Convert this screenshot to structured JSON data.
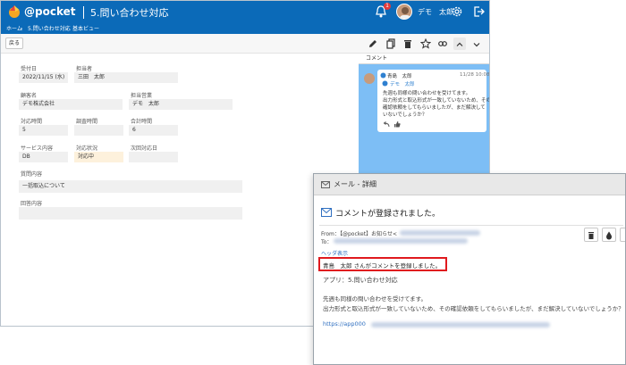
{
  "app": {
    "brand": "@pocket",
    "title": "5.問い合わせ対応",
    "notif_count": "1",
    "user_name": "デモ　太郎"
  },
  "breadcrumb": [
    "ホーム",
    "5.問い合わせ対応",
    "基本ビュー"
  ],
  "toolbar": {
    "back_label": "戻る"
  },
  "form": {
    "accept_date_label": "受付日",
    "accept_date": "2022/11/15 (水)",
    "staff_label": "担当者",
    "staff": "三田　太郎",
    "customer_label": "顧客名",
    "customer": "デモ株式会社",
    "sales_rep_label": "担当営業",
    "sales_rep": "デモ　太郎",
    "resp_time_label": "対応時間",
    "resp_time": "5",
    "research_time_label": "調査時間",
    "research_time": "",
    "total_time_label": "合計時間",
    "total_time": "6",
    "service_label": "サービス内容",
    "service": "DB",
    "status_label": "対応状況",
    "status": "対応中",
    "next_date_label": "次回対応日",
    "next_date": "",
    "question_label": "質問内容",
    "question": "一括取込について",
    "answer_label": "回答内容",
    "answer": ""
  },
  "side": {
    "tab": "コメント",
    "comment": {
      "author": "青島　太郎",
      "time": "11/28 10:08",
      "mention": "デモ　太郎",
      "line1": "先週も同様の問い合わせを受けてます。",
      "line2": "出力形式と取込形式が一致していないため、その",
      "line3": "確認依頼をしてもらいましたが、まだ解決して",
      "line4": "いないでしょうか？"
    }
  },
  "mail": {
    "header": "メール - 詳細",
    "subject": "コメントが登録されました。",
    "from_label": "From：",
    "from_value": "【@pocket】お知らせ<",
    "to_label": "To：",
    "header_link": "ヘッダ表示",
    "highlight_line": "青島　太郎 さんがコメントを登録しました。",
    "app_line": "アプリ：5.問い合わせ対応",
    "body1": "先週も同様の問い合わせを受けてます。",
    "body2": "出力形式と取込形式が一致していないため、その確認依頼をしてもらいましたが、まだ解決していないでしょうか？",
    "url": "https://app000"
  },
  "colors": {
    "brand_blue": "#0b6ab8",
    "side_blue": "#7dbef5",
    "highlight_red": "#e0191e"
  }
}
